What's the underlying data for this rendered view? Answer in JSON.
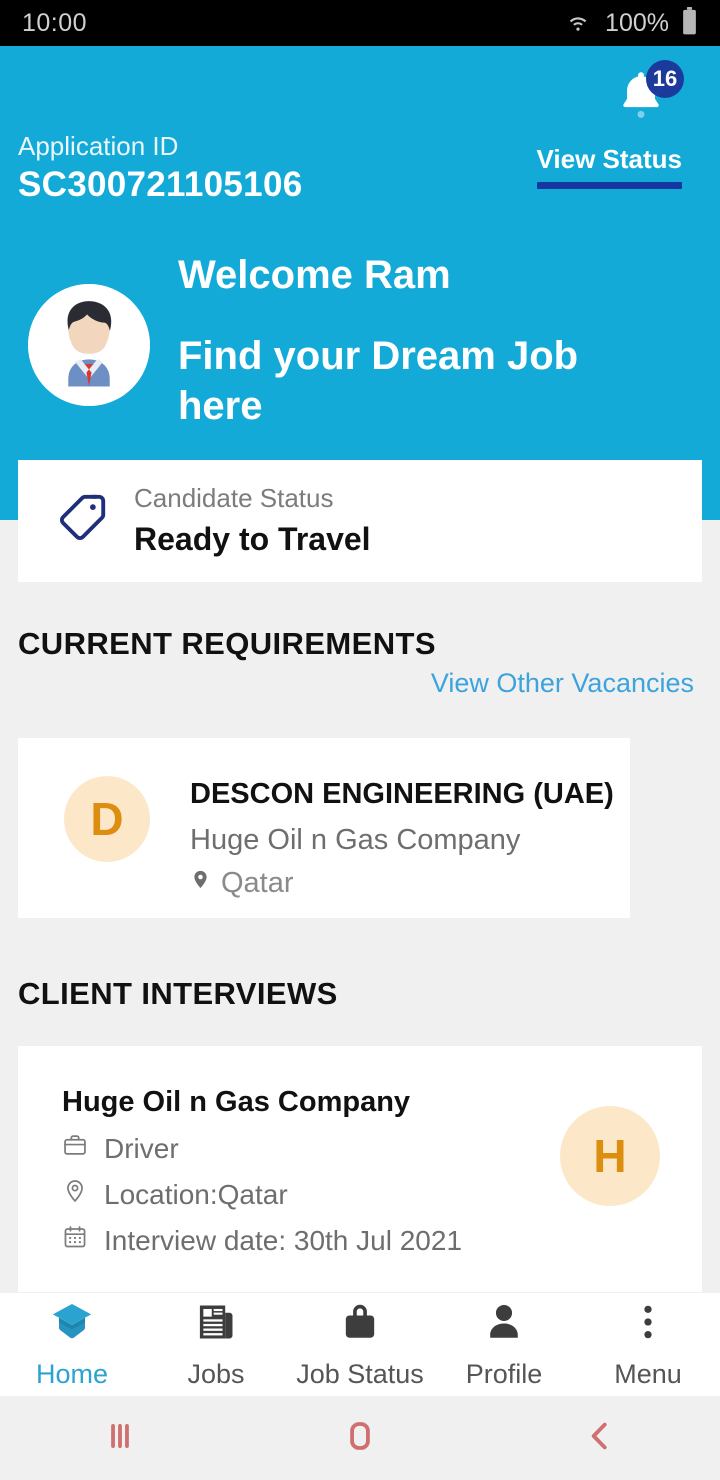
{
  "statusbar": {
    "time": "10:00",
    "battery_percent": "100%",
    "wifi_icon": "wifi-icon",
    "battery_icon": "battery-icon"
  },
  "header": {
    "notification_badge_count": "16",
    "bell_icon": "bell-icon",
    "application_id_label": "Application ID",
    "application_id_value": "SC300721105106",
    "view_status_label": "View Status",
    "welcome_line": "Welcome Ram",
    "tagline": "Find your Dream Job here",
    "avatar_icon": "user-avatar",
    "bg_color": "#14AAD8",
    "underline_color": "#1438A0"
  },
  "candidate_status": {
    "tag_icon": "tag-icon",
    "label": "Candidate Status",
    "value": "Ready to Travel"
  },
  "current_requirements": {
    "heading": "CURRENT REQUIREMENTS",
    "view_other_link": "View Other Vacancies",
    "items": [
      {
        "initial": "D",
        "company": "DESCON ENGINEERING (UAE)",
        "description": "Huge Oil n Gas Company",
        "location": "Qatar",
        "location_icon": "location-pin-icon"
      }
    ]
  },
  "client_interviews": {
    "heading": "CLIENT INTERVIEWS",
    "items": [
      {
        "initial": "H",
        "company": "Huge Oil n Gas Company",
        "role": "Driver",
        "role_icon": "briefcase-icon",
        "location": "Location:Qatar",
        "location_icon": "location-pin-icon",
        "date": "Interview date: 30th Jul 2021",
        "date_icon": "calendar-icon"
      }
    ]
  },
  "tabbar": {
    "active_color": "#2BA3D0",
    "items": [
      {
        "label": "Home",
        "icon": "graduation-cap-icon",
        "active": true
      },
      {
        "label": "Jobs",
        "icon": "newspaper-icon",
        "active": false
      },
      {
        "label": "Job Status",
        "icon": "briefcase-bag-icon",
        "active": false
      },
      {
        "label": "Profile",
        "icon": "person-icon",
        "active": false
      },
      {
        "label": "Menu",
        "icon": "three-dots-icon",
        "active": false
      }
    ]
  },
  "android_nav": {
    "recents_icon": "recents-icon",
    "home_icon": "home-square-icon",
    "back_icon": "back-chevron-icon",
    "color": "#cf6f6f"
  },
  "palette": {
    "avatar_circle_bg": "#FCE8C8",
    "avatar_letter": "#DD8E10",
    "page_bg": "#f0f0f0"
  }
}
